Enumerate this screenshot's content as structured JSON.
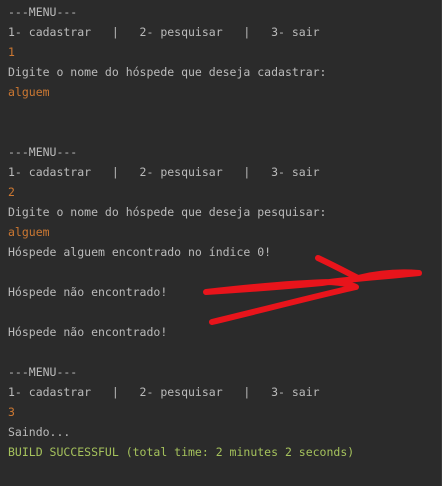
{
  "console": {
    "lines": [
      {
        "text": "---MENU---",
        "kind": "out"
      },
      {
        "text": "1- cadastrar   |   2- pesquisar   |   3- sair",
        "kind": "out"
      },
      {
        "text": "1",
        "kind": "in"
      },
      {
        "text": "Digite o nome do hóspede que deseja cadastrar:",
        "kind": "out"
      },
      {
        "text": "alguem",
        "kind": "in"
      },
      {
        "text": "---MENU---",
        "kind": "out"
      },
      {
        "text": "1- cadastrar   |   2- pesquisar   |   3- sair",
        "kind": "out"
      },
      {
        "text": "2",
        "kind": "in"
      },
      {
        "text": "Digite o nome do hóspede que deseja pesquisar:",
        "kind": "out"
      },
      {
        "text": "alguem",
        "kind": "in"
      },
      {
        "text": "Hóspede alguem encontrado no índice 0!",
        "kind": "out"
      },
      {
        "text": "Hóspede não encontrado!",
        "kind": "out"
      },
      {
        "text": "Hóspede não encontrado!",
        "kind": "out"
      },
      {
        "text": "---MENU---",
        "kind": "out"
      },
      {
        "text": "1- cadastrar   |   2- pesquisar   |   3- sair",
        "kind": "out"
      },
      {
        "text": "3",
        "kind": "in"
      },
      {
        "text": "Saindo...",
        "kind": "out"
      },
      {
        "text": "BUILD SUCCESSFUL (total time: 2 minutes 2 seconds)",
        "kind": "ok"
      }
    ]
  },
  "colors": {
    "background": "#2b2b2b",
    "output_text": "#bbbbbb",
    "input_text": "#cc7832",
    "success_text": "#a5c25c",
    "annotation": "#e8141b"
  }
}
